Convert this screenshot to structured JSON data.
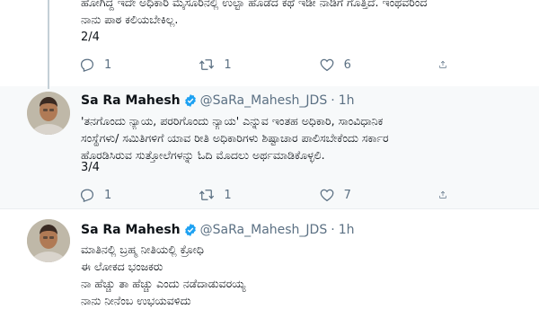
{
  "tweets": [
    {
      "lines": [
        "ಹೋಗಿದ್ದ ಇದೇ ಅಧಿಕಾರಿ ಮೈಸೂರಿನಲ್ಲಿ ಉಲ್ಟಾ ಹೊಡೆದ ಕಥೆ ಇಡೀ ನಾಡಿಗೆ ಗೊತ್ತಿದೆ. ಇಂಥವರಿಂದ",
        "ನಾನು ಪಾಠ ಕಲಿಯಬೇಕಿಲ್ಲ."
      ],
      "counter": "2/4",
      "replies": "1",
      "retweets": "1",
      "likes": "6"
    },
    {
      "name": "Sa Ra Mahesh",
      "handle": "@SaRa_Mahesh_JDS",
      "separator": "·",
      "time": "1h",
      "lines": [
        "'ತನಗೊಂದು ನ್ಯಾಯ, ಪರರಿಗೊಂದು ನ್ಯಾಯ' ಎನ್ನುವ ಇಂತಹ ಅಧಿಕಾರಿ, ಸಾಂವಿಧಾನಿಕ",
        "ಸಂಸ್ಥೆಗಳು/ ಸಮಿತಿಗಳಿಗೆ ಯಾವ ರೀತಿ ಅಧಿಕಾರಿಗಳು ಶಿಷ್ಟಾಚಾರ ಪಾಲಿಸಬೇಕೆಂದು ಸರ್ಕಾರ",
        "ಹೊರಡಿಸಿರುವ ಸುತ್ತೋಲೆಗಳನ್ನು ಓದಿ ಮೊದಲು ಅರ್ಥಮಾಡಿಕೊಳ್ಳಲಿ."
      ],
      "counter": "3/4",
      "replies": "1",
      "retweets": "1",
      "likes": "7"
    },
    {
      "name": "Sa Ra Mahesh",
      "handle": "@SaRa_Mahesh_JDS",
      "separator": "·",
      "time": "1h",
      "lines": [
        "ಮಾತಿನಲ್ಲಿ ಬ್ರಹ್ಮ ನೀತಿಯಲ್ಲಿ ಕ್ರೋಧಿ",
        "ಈ ಲೋಕದ ಭಂಜಕರು",
        "ನಾ ಹೆಚ್ಚು ತಾ ಹೆಚ್ಚು ಎಂದು ನಡೆದಾಡುವರಯ್ಯ",
        "ನಾನು ನೀನೆಂಬ ಉಭಯವಳಿದು"
      ]
    }
  ],
  "colors": {
    "accent": "#1da1f2",
    "muted": "#5b7083",
    "border": "#ebeef0"
  },
  "icons": [
    "reply-icon",
    "retweet-icon",
    "like-icon",
    "share-icon",
    "verified-badge-icon"
  ]
}
